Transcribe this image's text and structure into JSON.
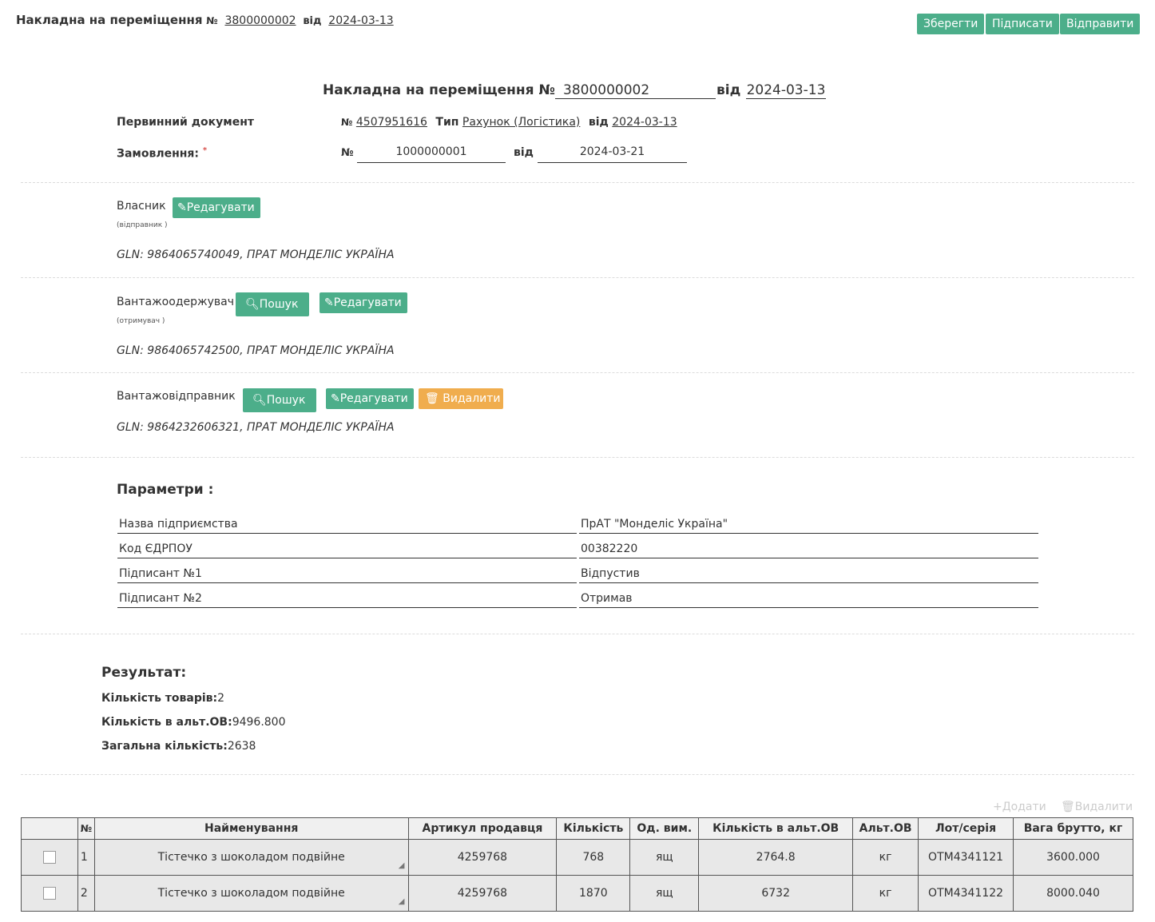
{
  "header": {
    "title": "Накладна на переміщення",
    "no_label": "№",
    "number": "3800000002",
    "from_label": "від",
    "date": "2024-03-13",
    "buttons": {
      "save": "Зберегти",
      "sign": "Підписати",
      "send": "Відправити"
    }
  },
  "form": {
    "title": "Накладна на переміщення №",
    "number": "3800000002",
    "from_label": "від",
    "date": "2024-03-13",
    "primary_doc": {
      "label": "Первинний документ",
      "no_label": "№",
      "number": "4507951616",
      "type_label": "Тип",
      "type": "Рахунок (Логістика)",
      "from_label": "від",
      "date": "2024-03-13"
    },
    "order": {
      "label": "Замовлення:",
      "required": "*",
      "no_label": "№",
      "number": "1000000001",
      "from_label": "від",
      "date": "2024-03-21"
    }
  },
  "owner": {
    "label": "Власник",
    "sub": "(відправник )",
    "edit": "Редагувати",
    "gln": "GLN: 9864065740049, ПРАТ МОНДЕЛІС УКРАЇНА"
  },
  "consignee": {
    "label": "Вантажоодержувач",
    "sub": "(отримувач )",
    "search": "Пошук",
    "edit": "Редагувати",
    "gln": "GLN: 9864065742500, ПРАТ МОНДЕЛІС УКРАЇНА"
  },
  "shipper": {
    "label": "Вантажовідправник",
    "search": "Пошук",
    "edit": "Редагувати",
    "delete": "Видалити",
    "gln": "GLN: 9864232606321, ПРАТ МОНДЕЛІС УКРАЇНА"
  },
  "params": {
    "title": "Параметри :",
    "rows": [
      {
        "name": "Назва підприємства",
        "value": "ПрАТ \"Монделіс Україна\""
      },
      {
        "name": "Код ЄДРПОУ",
        "value": "00382220"
      },
      {
        "name": "Підписант №1",
        "value": "Відпустив"
      },
      {
        "name": "Підписант №2",
        "value": "Отримав"
      }
    ]
  },
  "result": {
    "title": "Результат:",
    "count_label": "Кількість товарів:",
    "count": "2",
    "alt_label": "Кількість в альт.ОВ:",
    "alt": "9496.800",
    "total_label": "Загальна кількість:",
    "total": "2638"
  },
  "table_actions": {
    "add": "Додати",
    "delete": "Видалити"
  },
  "table": {
    "headers": [
      "",
      "№",
      "Найменування",
      "Артикул продавця",
      "Кількість",
      "Од. вим.",
      "Кількість в альт.ОВ",
      "Альт.ОВ",
      "Лот/серія",
      "Вага брутто, кг"
    ],
    "rows": [
      [
        "",
        "1",
        "Тістечко з шоколадом подвійне",
        "4259768",
        "768",
        "ящ",
        "2764.8",
        "кг",
        "ОТМ4341121",
        "3600.000"
      ],
      [
        "",
        "2",
        "Тістечко з шоколадом подвійне",
        "4259768",
        "1870",
        "ящ",
        "6732",
        "кг",
        "ОТМ4341122",
        "8000.040"
      ]
    ]
  }
}
